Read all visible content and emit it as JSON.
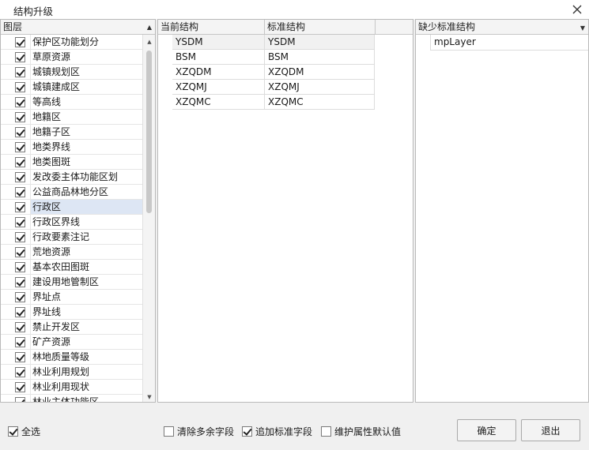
{
  "window": {
    "title": "结构升级"
  },
  "left_panel": {
    "header": "图层",
    "layers": [
      {
        "name": "保护区功能划分",
        "checked": true
      },
      {
        "name": "草原资源",
        "checked": true
      },
      {
        "name": "城镇规划区",
        "checked": true
      },
      {
        "name": "城镇建成区",
        "checked": true
      },
      {
        "name": "等高线",
        "checked": true
      },
      {
        "name": "地籍区",
        "checked": true
      },
      {
        "name": "地籍子区",
        "checked": true
      },
      {
        "name": "地类界线",
        "checked": true
      },
      {
        "name": "地类图斑",
        "checked": true
      },
      {
        "name": "发改委主体功能区划",
        "checked": true
      },
      {
        "name": "公益商品林地分区",
        "checked": true
      },
      {
        "name": "行政区",
        "checked": true,
        "selected": true
      },
      {
        "name": "行政区界线",
        "checked": true
      },
      {
        "name": "行政要素注记",
        "checked": true
      },
      {
        "name": "荒地资源",
        "checked": true
      },
      {
        "name": "基本农田图斑",
        "checked": true
      },
      {
        "name": "建设用地管制区",
        "checked": true
      },
      {
        "name": "界址点",
        "checked": true
      },
      {
        "name": "界址线",
        "checked": true
      },
      {
        "name": "禁止开发区",
        "checked": true
      },
      {
        "name": "矿产资源",
        "checked": true
      },
      {
        "name": "林地质量等级",
        "checked": true
      },
      {
        "name": "林业利用规划",
        "checked": true
      },
      {
        "name": "林业利用现状",
        "checked": true
      },
      {
        "name": "林业主体功能区",
        "checked": true
      }
    ]
  },
  "mid_panel": {
    "headers": [
      "当前结构",
      "标准结构"
    ],
    "rows": [
      {
        "current": "YSDM",
        "standard": "YSDM"
      },
      {
        "current": "BSM",
        "standard": "BSM"
      },
      {
        "current": "XZQDM",
        "standard": "XZQDM"
      },
      {
        "current": "XZQMJ",
        "standard": "XZQMJ"
      },
      {
        "current": "XZQMC",
        "standard": "XZQMC"
      }
    ]
  },
  "right_panel": {
    "header": "缺少标准结构",
    "items": [
      "mpLayer"
    ]
  },
  "bottom": {
    "select_all": {
      "label": "全选",
      "checked": true
    },
    "clear_extra": {
      "label": "清除多余字段",
      "checked": false
    },
    "append_standard": {
      "label": "追加标准字段",
      "checked": true
    },
    "maintain_default": {
      "label": "维护属性默认值",
      "checked": false
    },
    "ok_label": "确定",
    "exit_label": "退出"
  },
  "icons": {
    "close": "close-icon",
    "sort": "sort-up-icon",
    "dropdown": "chevron-down-icon",
    "scroll_up": "scroll-up-icon",
    "scroll_down": "scroll-down-icon"
  },
  "colors": {
    "selected_row": "#dde6f4",
    "panel_border": "#b9b9b9",
    "window_bg": "#f0f0f0"
  }
}
